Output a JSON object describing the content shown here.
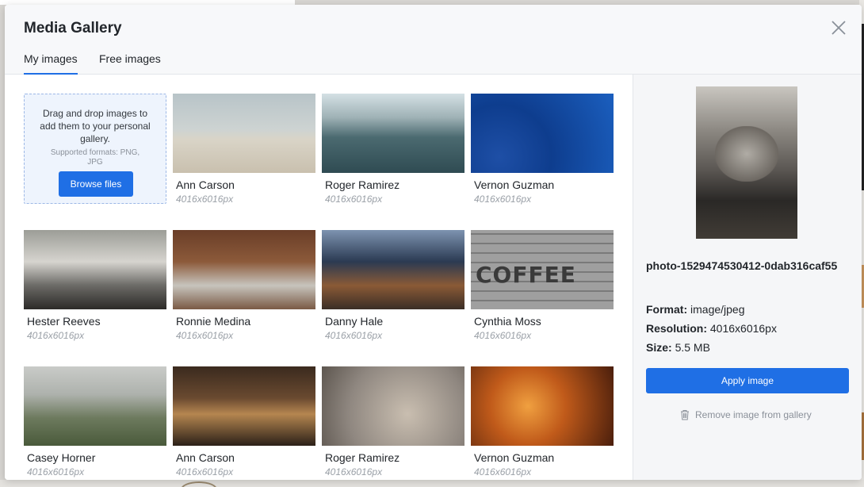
{
  "modal": {
    "title": "Media Gallery",
    "tabs": [
      {
        "label": "My images",
        "active": true
      },
      {
        "label": "Free images",
        "active": false
      }
    ]
  },
  "dropzone": {
    "text": "Drag and drop images to add them to your personal gallery.",
    "formats": "Supported formats: PNG, JPG",
    "browse_label": "Browse files"
  },
  "gallery": [
    {
      "name": "Ann Carson",
      "resolution": "4016x6016px"
    },
    {
      "name": "Roger Ramirez",
      "resolution": "4016x6016px"
    },
    {
      "name": "Vernon Guzman",
      "resolution": "4016x6016px"
    },
    {
      "name": "Hester Reeves",
      "resolution": "4016x6016px"
    },
    {
      "name": "Ronnie Medina",
      "resolution": "4016x6016px"
    },
    {
      "name": "Danny Hale",
      "resolution": "4016x6016px"
    },
    {
      "name": "Cynthia Moss",
      "resolution": "4016x6016px",
      "thumb_text": "COFFEE"
    },
    {
      "name": "Casey Horner",
      "resolution": "4016x6016px"
    },
    {
      "name": "Ann Carson",
      "resolution": "4016x6016px"
    },
    {
      "name": "Roger Ramirez",
      "resolution": "4016x6016px"
    },
    {
      "name": "Vernon Guzman",
      "resolution": "4016x6016px"
    }
  ],
  "details": {
    "file_name": "photo-1529474530412-0dab316caf55",
    "format_label": "Format:",
    "format_value": "image/jpeg",
    "resolution_label": "Resolution:",
    "resolution_value": "4016x6016px",
    "size_label": "Size:",
    "size_value": "5.5 MB",
    "apply_label": "Apply image",
    "remove_label": "Remove image from gallery"
  },
  "colors": {
    "accent": "#1f6fe5",
    "header_bg": "#f7f8fa",
    "detail_bg": "#f5f6f8"
  }
}
